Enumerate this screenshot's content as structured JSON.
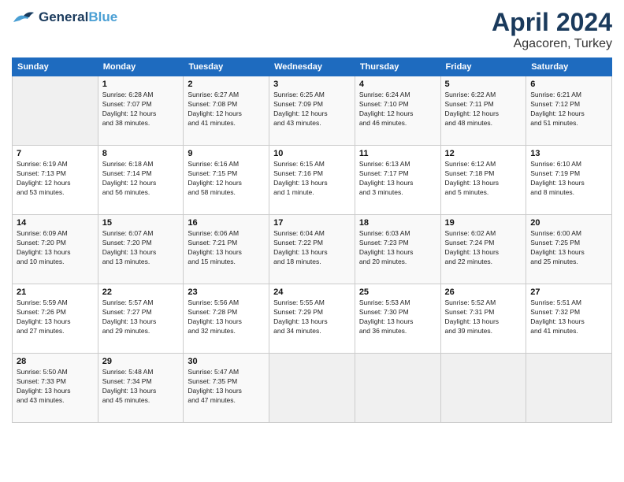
{
  "header": {
    "logo_line1": "General",
    "logo_line2": "Blue",
    "title": "April 2024",
    "subtitle": "Agacoren, Turkey"
  },
  "weekdays": [
    "Sunday",
    "Monday",
    "Tuesday",
    "Wednesday",
    "Thursday",
    "Friday",
    "Saturday"
  ],
  "weeks": [
    [
      {
        "day": "",
        "info": ""
      },
      {
        "day": "1",
        "info": "Sunrise: 6:28 AM\nSunset: 7:07 PM\nDaylight: 12 hours\nand 38 minutes."
      },
      {
        "day": "2",
        "info": "Sunrise: 6:27 AM\nSunset: 7:08 PM\nDaylight: 12 hours\nand 41 minutes."
      },
      {
        "day": "3",
        "info": "Sunrise: 6:25 AM\nSunset: 7:09 PM\nDaylight: 12 hours\nand 43 minutes."
      },
      {
        "day": "4",
        "info": "Sunrise: 6:24 AM\nSunset: 7:10 PM\nDaylight: 12 hours\nand 46 minutes."
      },
      {
        "day": "5",
        "info": "Sunrise: 6:22 AM\nSunset: 7:11 PM\nDaylight: 12 hours\nand 48 minutes."
      },
      {
        "day": "6",
        "info": "Sunrise: 6:21 AM\nSunset: 7:12 PM\nDaylight: 12 hours\nand 51 minutes."
      }
    ],
    [
      {
        "day": "7",
        "info": "Sunrise: 6:19 AM\nSunset: 7:13 PM\nDaylight: 12 hours\nand 53 minutes."
      },
      {
        "day": "8",
        "info": "Sunrise: 6:18 AM\nSunset: 7:14 PM\nDaylight: 12 hours\nand 56 minutes."
      },
      {
        "day": "9",
        "info": "Sunrise: 6:16 AM\nSunset: 7:15 PM\nDaylight: 12 hours\nand 58 minutes."
      },
      {
        "day": "10",
        "info": "Sunrise: 6:15 AM\nSunset: 7:16 PM\nDaylight: 13 hours\nand 1 minute."
      },
      {
        "day": "11",
        "info": "Sunrise: 6:13 AM\nSunset: 7:17 PM\nDaylight: 13 hours\nand 3 minutes."
      },
      {
        "day": "12",
        "info": "Sunrise: 6:12 AM\nSunset: 7:18 PM\nDaylight: 13 hours\nand 5 minutes."
      },
      {
        "day": "13",
        "info": "Sunrise: 6:10 AM\nSunset: 7:19 PM\nDaylight: 13 hours\nand 8 minutes."
      }
    ],
    [
      {
        "day": "14",
        "info": "Sunrise: 6:09 AM\nSunset: 7:20 PM\nDaylight: 13 hours\nand 10 minutes."
      },
      {
        "day": "15",
        "info": "Sunrise: 6:07 AM\nSunset: 7:20 PM\nDaylight: 13 hours\nand 13 minutes."
      },
      {
        "day": "16",
        "info": "Sunrise: 6:06 AM\nSunset: 7:21 PM\nDaylight: 13 hours\nand 15 minutes."
      },
      {
        "day": "17",
        "info": "Sunrise: 6:04 AM\nSunset: 7:22 PM\nDaylight: 13 hours\nand 18 minutes."
      },
      {
        "day": "18",
        "info": "Sunrise: 6:03 AM\nSunset: 7:23 PM\nDaylight: 13 hours\nand 20 minutes."
      },
      {
        "day": "19",
        "info": "Sunrise: 6:02 AM\nSunset: 7:24 PM\nDaylight: 13 hours\nand 22 minutes."
      },
      {
        "day": "20",
        "info": "Sunrise: 6:00 AM\nSunset: 7:25 PM\nDaylight: 13 hours\nand 25 minutes."
      }
    ],
    [
      {
        "day": "21",
        "info": "Sunrise: 5:59 AM\nSunset: 7:26 PM\nDaylight: 13 hours\nand 27 minutes."
      },
      {
        "day": "22",
        "info": "Sunrise: 5:57 AM\nSunset: 7:27 PM\nDaylight: 13 hours\nand 29 minutes."
      },
      {
        "day": "23",
        "info": "Sunrise: 5:56 AM\nSunset: 7:28 PM\nDaylight: 13 hours\nand 32 minutes."
      },
      {
        "day": "24",
        "info": "Sunrise: 5:55 AM\nSunset: 7:29 PM\nDaylight: 13 hours\nand 34 minutes."
      },
      {
        "day": "25",
        "info": "Sunrise: 5:53 AM\nSunset: 7:30 PM\nDaylight: 13 hours\nand 36 minutes."
      },
      {
        "day": "26",
        "info": "Sunrise: 5:52 AM\nSunset: 7:31 PM\nDaylight: 13 hours\nand 39 minutes."
      },
      {
        "day": "27",
        "info": "Sunrise: 5:51 AM\nSunset: 7:32 PM\nDaylight: 13 hours\nand 41 minutes."
      }
    ],
    [
      {
        "day": "28",
        "info": "Sunrise: 5:50 AM\nSunset: 7:33 PM\nDaylight: 13 hours\nand 43 minutes."
      },
      {
        "day": "29",
        "info": "Sunrise: 5:48 AM\nSunset: 7:34 PM\nDaylight: 13 hours\nand 45 minutes."
      },
      {
        "day": "30",
        "info": "Sunrise: 5:47 AM\nSunset: 7:35 PM\nDaylight: 13 hours\nand 47 minutes."
      },
      {
        "day": "",
        "info": ""
      },
      {
        "day": "",
        "info": ""
      },
      {
        "day": "",
        "info": ""
      },
      {
        "day": "",
        "info": ""
      }
    ]
  ]
}
